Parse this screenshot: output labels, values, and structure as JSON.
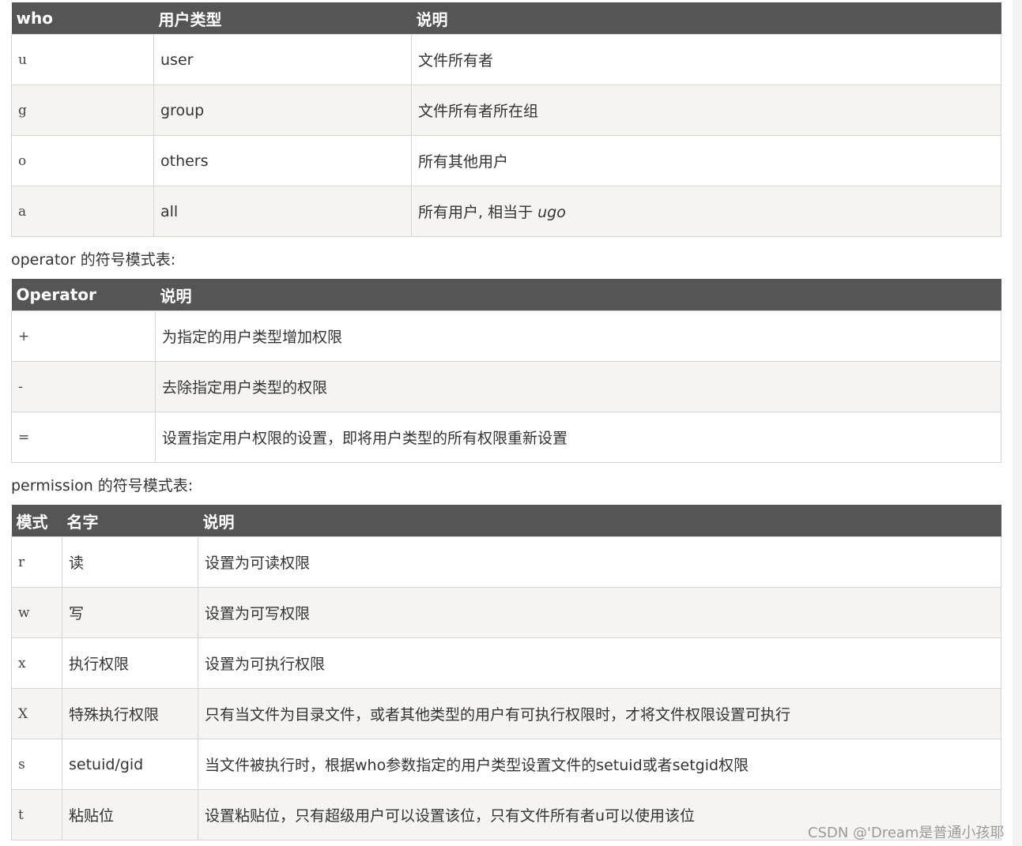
{
  "who_table": {
    "headers": [
      "who",
      "用户类型",
      "说明"
    ],
    "rows": [
      [
        "u",
        "user",
        "文件所有者"
      ],
      [
        "g",
        "group",
        "文件所有者所在组"
      ],
      [
        "o",
        "others",
        "所有其他用户"
      ],
      [
        "a",
        "all",
        "所有用户, 相当于 ",
        "ugo"
      ]
    ]
  },
  "operator_caption": "operator 的符号模式表:",
  "operator_table": {
    "headers": [
      "Operator",
      "说明"
    ],
    "rows": [
      [
        "+",
        "为指定的用户类型增加权限"
      ],
      [
        "-",
        "去除指定用户类型的权限"
      ],
      [
        "=",
        "设置指定用户权限的设置，即将用户类型的所有权限重新设置"
      ]
    ]
  },
  "permission_caption": "permission 的符号模式表:",
  "permission_table": {
    "headers": [
      "模式",
      "名字",
      "说明"
    ],
    "rows": [
      [
        "r",
        "读",
        "设置为可读权限"
      ],
      [
        "w",
        "写",
        "设置为可写权限"
      ],
      [
        "x",
        "执行权限",
        "设置为可执行权限"
      ],
      [
        "X",
        "特殊执行权限",
        "只有当文件为目录文件，或者其他类型的用户有可执行权限时，才将文件权限设置可执行"
      ],
      [
        "s",
        "setuid/gid",
        "当文件被执行时，根据who参数指定的用户类型设置文件的setuid或者setgid权限"
      ],
      [
        "t",
        "粘贴位",
        "设置粘贴位，只有超级用户可以设置该位，只有文件所有者u可以使用该位"
      ]
    ]
  },
  "watermark": "CSDN @'Dream是普通小孩耶"
}
